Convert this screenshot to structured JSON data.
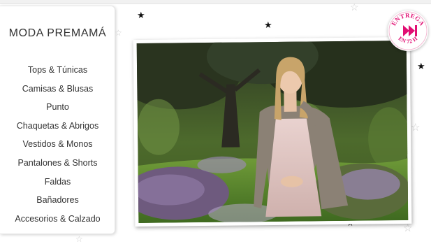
{
  "menu": {
    "title": "MODA PREMAMÁ",
    "items": [
      {
        "label": "Tops & Túnicas"
      },
      {
        "label": "Camisas & Blusas"
      },
      {
        "label": "Punto"
      },
      {
        "label": "Chaquetas & Abrigos"
      },
      {
        "label": "Vestidos & Monos"
      },
      {
        "label": "Pantalones & Shorts"
      },
      {
        "label": "Faldas"
      },
      {
        "label": "Bañadores"
      },
      {
        "label": "Accesorios & Calzado"
      }
    ]
  },
  "badge": {
    "top_text": "ENTREGA",
    "bottom_text": "EN 72 H",
    "accent": "#e10f73"
  },
  "colors": {
    "menu_text": "#333333",
    "star_solid": "#111111",
    "star_outline": "#cfcfcf"
  }
}
